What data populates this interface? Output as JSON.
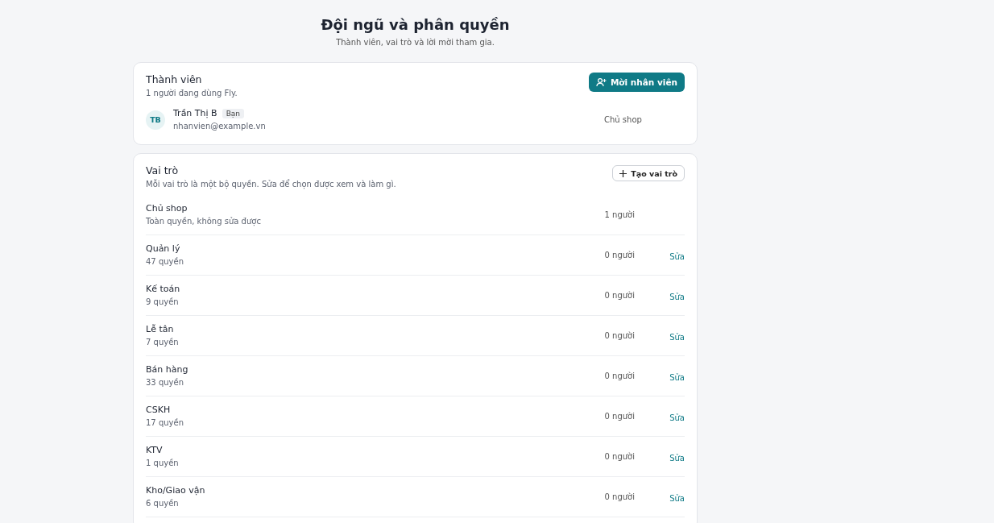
{
  "header": {
    "title": "Đội ngũ và phân quyền",
    "subtitle": "Thành viên, vai trò và lời mời tham gia."
  },
  "members": {
    "title": "Thành viên",
    "subtitle": "1 người đang dùng Fly.",
    "invite_button": "Mời nhân viên",
    "list": [
      {
        "initials": "TB",
        "name": "Trần Thị B",
        "badge": "Bạn",
        "email": "nhanvien@example.vn",
        "role": "Chủ shop"
      }
    ]
  },
  "roles": {
    "title": "Vai trò",
    "subtitle": "Mỗi vai trò là một bộ quyền. Sửa để chọn được xem và làm gì.",
    "create_button": "Tạo vai trò",
    "list": [
      {
        "name": "Chủ shop",
        "detail": "Toàn quyền, không sửa được",
        "count": "1 người"
      },
      {
        "name": "Quản lý",
        "detail": "47 quyền",
        "count": "0 người",
        "action": "Sửa"
      },
      {
        "name": "Kế toán",
        "detail": "9 quyền",
        "count": "0 người",
        "action": "Sửa"
      },
      {
        "name": "Lễ tân",
        "detail": "7 quyền",
        "count": "0 người",
        "action": "Sửa"
      },
      {
        "name": "Bán hàng",
        "detail": "33 quyền",
        "count": "0 người",
        "action": "Sửa"
      },
      {
        "name": "CSKH",
        "detail": "17 quyền",
        "count": "0 người",
        "action": "Sửa"
      },
      {
        "name": "KTV",
        "detail": "1 quyền",
        "count": "0 người",
        "action": "Sửa"
      },
      {
        "name": "Kho/Giao vận",
        "detail": "6 quyền",
        "count": "0 người",
        "action": "Sửa"
      }
    ]
  }
}
